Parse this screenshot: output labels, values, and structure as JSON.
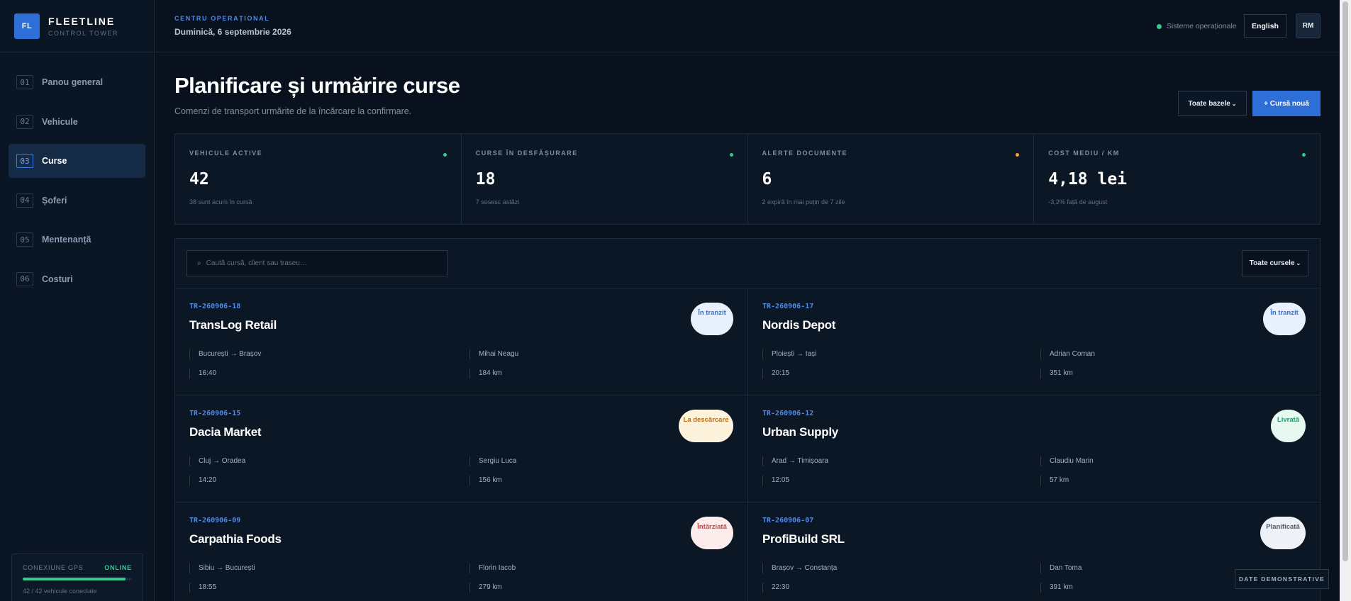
{
  "brand": {
    "logo": "FL",
    "name": "FLEETLINE",
    "subtitle": "CONTROL TOWER"
  },
  "nav": [
    {
      "num": "01",
      "label": "Panou general"
    },
    {
      "num": "02",
      "label": "Vehicule"
    },
    {
      "num": "03",
      "label": "Curse",
      "active": true
    },
    {
      "num": "04",
      "label": "Șoferi"
    },
    {
      "num": "05",
      "label": "Mentenanță"
    },
    {
      "num": "06",
      "label": "Costuri"
    }
  ],
  "gps": {
    "label": "CONEXIUNE GPS",
    "status": "ONLINE",
    "progress": 1.0,
    "detail": "42 / 42 vehicule conectate"
  },
  "header": {
    "kicker": "CENTRU OPERAȚIONAL",
    "date": "Duminică, 6 septembrie 2026",
    "system_status": "Sisteme operaționale",
    "language": "English",
    "user_initials": "RM"
  },
  "page": {
    "title": "Planificare și urmărire curse",
    "subtitle": "Comenzi de transport urmărite de la încărcare la confirmare.",
    "bases_button": "Toate bazele",
    "new_button": "+ Cursă nouă"
  },
  "stats": [
    {
      "label": "VEHICULE ACTIVE",
      "value": "42",
      "note": "38 sunt acum în cursă",
      "dot_color": "#35c98d"
    },
    {
      "label": "CURSE ÎN DESFĂȘURARE",
      "value": "18",
      "note": "7 sosesc astăzi",
      "dot_color": "#35c98d"
    },
    {
      "label": "ALERTE DOCUMENTE",
      "value": "6",
      "note": "2 expiră în mai puțin de 7 zile",
      "dot_color": "#f0a53a"
    },
    {
      "label": "COST MEDIU / KM",
      "value": "4,18 lei",
      "note": "-3,2% față de august",
      "dot_color": "#35c98d"
    }
  ],
  "search": {
    "placeholder": "Caută cursă, client sau traseu…",
    "icon": "search-icon"
  },
  "filter_button": "Toate cursele",
  "trips": [
    {
      "id": "TR-260906-18",
      "client": "TransLog Retail",
      "status": "În tranzit",
      "status_type": "transit",
      "route": "București → Brașov",
      "driver": "Mihai Neagu",
      "time": "16:40",
      "distance": "184 km"
    },
    {
      "id": "TR-260906-17",
      "client": "Nordis Depot",
      "status": "În tranzit",
      "status_type": "transit",
      "route": "Ploiești → Iași",
      "driver": "Adrian Coman",
      "time": "20:15",
      "distance": "351 km"
    },
    {
      "id": "TR-260906-15",
      "client": "Dacia Market",
      "status": "La descărcare",
      "status_type": "unload",
      "route": "Cluj → Oradea",
      "driver": "Sergiu Luca",
      "time": "14:20",
      "distance": "156 km"
    },
    {
      "id": "TR-260906-12",
      "client": "Urban Supply",
      "status": "Livrată",
      "status_type": "delivered",
      "route": "Arad → Timișoara",
      "driver": "Claudiu Marin",
      "time": "12:05",
      "distance": "57 km"
    },
    {
      "id": "TR-260906-09",
      "client": "Carpathia Foods",
      "status": "Întârziată",
      "status_type": "late",
      "route": "Sibiu → București",
      "driver": "Florin Iacob",
      "time": "18:55",
      "distance": "279 km"
    },
    {
      "id": "TR-260906-07",
      "client": "ProfiBuild SRL",
      "status": "Planificată",
      "status_type": "planned",
      "route": "Brașov → Constanța",
      "driver": "Dan Toma",
      "time": "22:30",
      "distance": "391 km"
    }
  ],
  "demo_tag": "DATE DEMONSTRATIVE"
}
